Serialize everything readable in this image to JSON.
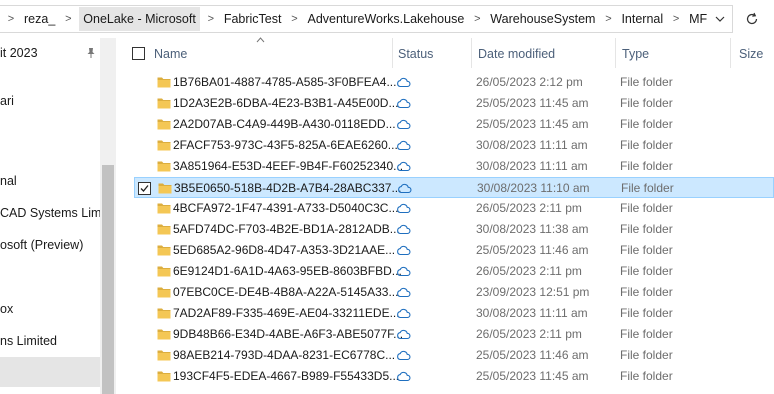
{
  "address": {
    "segments": [
      "reza_",
      "OneLake - Microsoft",
      "FabricTest",
      "AdventureWorks.Lakehouse",
      "WarehouseSystem",
      "Internal",
      "MF"
    ]
  },
  "sidebar": {
    "items": [
      "it 2023",
      "ari",
      "nal",
      "CAD Systems Limit",
      "osoft (Preview)",
      "ox",
      "ns Limited"
    ]
  },
  "columns": {
    "name": "Name",
    "status": "Status",
    "date": "Date modified",
    "type": "Type",
    "size": "Size"
  },
  "rows": [
    {
      "name": "1B76BA01-4887-4785-A585-3F0BFEA4...",
      "date": "26/05/2023 2:12 pm",
      "type": "File folder",
      "selected": false
    },
    {
      "name": "1D2A3E2B-6DBA-4E23-B3B1-A45E00D...",
      "date": "25/05/2023 11:45 am",
      "type": "File folder",
      "selected": false
    },
    {
      "name": "2A2D07AB-C4A9-449B-A430-0118EDD...",
      "date": "25/05/2023 11:45 am",
      "type": "File folder",
      "selected": false
    },
    {
      "name": "2FACF753-973C-43F5-825A-6EAE6260...",
      "date": "30/08/2023 11:11 am",
      "type": "File folder",
      "selected": false
    },
    {
      "name": "3A851964-E53D-4EEF-9B4F-F60252340...",
      "date": "30/08/2023 11:11 am",
      "type": "File folder",
      "selected": false
    },
    {
      "name": "3B5E0650-518B-4D2B-A7B4-28ABC337...",
      "date": "30/08/2023 11:10 am",
      "type": "File folder",
      "selected": true
    },
    {
      "name": "4BCFA972-1F47-4391-A733-D5040C3C...",
      "date": "26/05/2023 2:11 pm",
      "type": "File folder",
      "selected": false
    },
    {
      "name": "5AFD74DC-F703-4B2E-BD1A-2812ADB...",
      "date": "30/08/2023 11:38 am",
      "type": "File folder",
      "selected": false
    },
    {
      "name": "5ED685A2-96D8-4D47-A353-3D21AAE...",
      "date": "25/05/2023 11:46 am",
      "type": "File folder",
      "selected": false
    },
    {
      "name": "6E9124D1-6A1D-4A63-95EB-8603BFBD...",
      "date": "26/05/2023 2:11 pm",
      "type": "File folder",
      "selected": false
    },
    {
      "name": "07EBC0CE-DE4B-4B8A-A22A-5145A33...",
      "date": "23/09/2023 12:51 pm",
      "type": "File folder",
      "selected": false
    },
    {
      "name": "7AD2AF89-F335-469E-AE04-33211EDE...",
      "date": "30/08/2023 11:11 am",
      "type": "File folder",
      "selected": false
    },
    {
      "name": "9DB48B66-E34D-4ABE-A6F3-ABE5077F...",
      "date": "26/05/2023 2:11 pm",
      "type": "File folder",
      "selected": false
    },
    {
      "name": "98AEB214-793D-4DAA-8231-EC6778C...",
      "date": "25/05/2023 11:46 am",
      "type": "File folder",
      "selected": false
    },
    {
      "name": "193CF4F5-EDEA-4667-B989-F55433D5...",
      "date": "25/05/2023 11:45 am",
      "type": "File folder",
      "selected": false
    }
  ],
  "icons": {
    "status": "cloud-icon",
    "folder": "folder-icon",
    "refresh": "refresh-icon",
    "pin": "pin-icon"
  },
  "colors": {
    "folder": "#f4c755",
    "cloud": "#1f6fbf",
    "selection": "#cce8ff",
    "header_text": "#4c607a"
  }
}
